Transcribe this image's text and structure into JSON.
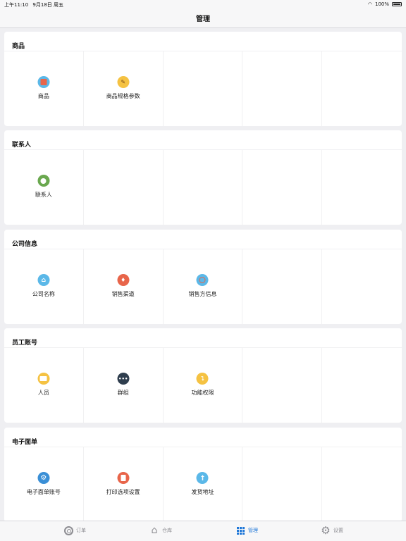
{
  "status_bar": {
    "time": "上午11:10",
    "date": "9月18日 周五",
    "battery": "100%"
  },
  "nav": {
    "title": "管理"
  },
  "sections": [
    {
      "title": "商品",
      "items": [
        {
          "label": "商品",
          "icon": "product-icon",
          "color": "#e8654a",
          "bg": "#5bb8e8"
        },
        {
          "label": "商品规格参数",
          "icon": "spec-params-icon",
          "color": "#f5c242",
          "bg": "#f5c242"
        }
      ]
    },
    {
      "title": "联系人",
      "items": [
        {
          "label": "联系人",
          "icon": "contact-icon",
          "color": "#6aa84f",
          "bg": "#6aa84f"
        }
      ]
    },
    {
      "title": "公司信息",
      "items": [
        {
          "label": "公司名称",
          "icon": "bank-building-icon",
          "color": "#5bb8e8",
          "bg": "#5bb8e8"
        },
        {
          "label": "销售渠道",
          "icon": "sales-channel-icon",
          "color": "#e8654a",
          "bg": "#e8654a"
        },
        {
          "label": "销售方信息",
          "icon": "globe-icon",
          "color": "#5bb8e8",
          "bg": "#5bb8e8"
        }
      ]
    },
    {
      "title": "员工账号",
      "items": [
        {
          "label": "人员",
          "icon": "id-card-icon",
          "color": "#f5c242",
          "bg": "#f5c242"
        },
        {
          "label": "群组",
          "icon": "group-icon",
          "color": "#2f3e4e",
          "bg": "#2f3e4e"
        },
        {
          "label": "功能权限",
          "icon": "key-icon",
          "color": "#f5c242",
          "bg": "#f5c242"
        }
      ]
    },
    {
      "title": "电子面单",
      "items": [
        {
          "label": "电子面单账号",
          "icon": "gear-badge-icon",
          "color": "#3a8fd6",
          "bg": "#3a8fd6"
        },
        {
          "label": "打印选项设置",
          "icon": "document-icon",
          "color": "#e8654a",
          "bg": "#e8654a"
        },
        {
          "label": "发货地址",
          "icon": "location-icon",
          "color": "#5bb8e8",
          "bg": "#5bb8e8"
        }
      ]
    }
  ],
  "tabs": [
    {
      "label": "订单",
      "icon": "order-ring-icon",
      "active": false
    },
    {
      "label": "仓库",
      "icon": "warehouse-icon",
      "active": false
    },
    {
      "label": "管理",
      "icon": "grid-icon",
      "active": true
    },
    {
      "label": "设置",
      "icon": "gear-icon",
      "active": false
    }
  ],
  "colors": {
    "accent": "#1f77d8",
    "inactive": "#8e8e93",
    "background": "#efeff2"
  }
}
